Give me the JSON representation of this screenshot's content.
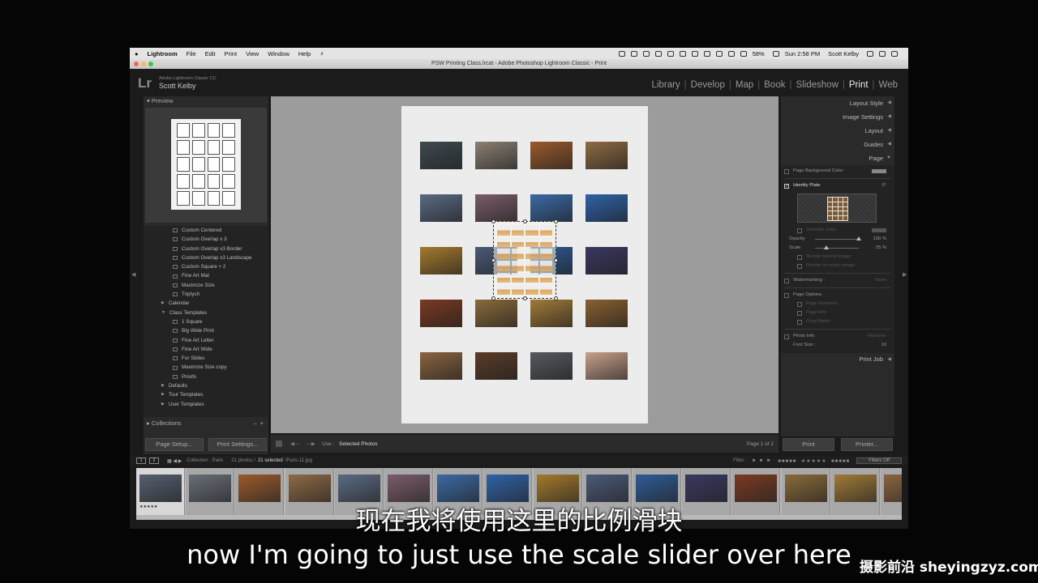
{
  "menubar": {
    "apple_icon": "apple-icon",
    "app": "Lightroom",
    "items": [
      "File",
      "Edit",
      "Print",
      "View",
      "Window",
      "Help"
    ],
    "battery": "58%",
    "clock": "Sun 2:58 PM",
    "user": "Scott Kelby"
  },
  "titlebar": {
    "title": "PSW Printing Class.lrcat - Adobe Photoshop Lightroom Classic - Print"
  },
  "identity": {
    "logo": "Lr",
    "product": "Adobe Lightroom Classic CC",
    "user": "Scott Kelby"
  },
  "modules": [
    "Library",
    "Develop",
    "Map",
    "Book",
    "Slideshow",
    "Print",
    "Web"
  ],
  "active_module": "Print",
  "left_panel": {
    "preview_header": "Preview",
    "template_rows": [
      {
        "type": "item",
        "label": "Custom Centered"
      },
      {
        "type": "item",
        "label": "Custom Overlap x 3"
      },
      {
        "type": "item",
        "label": "Custom Overlap x3 Border"
      },
      {
        "type": "item",
        "label": "Custom Overlap x3 Landscape"
      },
      {
        "type": "item",
        "label": "Custom Square + 2"
      },
      {
        "type": "item",
        "label": "Fine Art Mat"
      },
      {
        "type": "item",
        "label": "Maximize Size"
      },
      {
        "type": "item",
        "label": "Triptych"
      },
      {
        "type": "folder",
        "label": "Calendar",
        "open": false
      },
      {
        "type": "folder",
        "label": "Class Templates",
        "open": true
      },
      {
        "type": "item",
        "label": "1 Square"
      },
      {
        "type": "item",
        "label": "Big Wide Print"
      },
      {
        "type": "item",
        "label": "Fine Art Letter"
      },
      {
        "type": "item",
        "label": "Fine Art Wide"
      },
      {
        "type": "item",
        "label": "For Slides"
      },
      {
        "type": "item",
        "label": "Maximize Size copy"
      },
      {
        "type": "item",
        "label": "Proofs"
      },
      {
        "type": "folder",
        "label": "Defaults",
        "open": false
      },
      {
        "type": "folder",
        "label": "Tour Templates",
        "open": false
      },
      {
        "type": "folder",
        "label": "User Templates",
        "open": false
      }
    ],
    "collections_header": "Collections",
    "page_setup": "Page Setup...",
    "print_settings": "Print Settings..."
  },
  "toolbar": {
    "use_label": "Use :",
    "use_value": "Selected Photos",
    "page_counter": "Page 1 of 2"
  },
  "page_thumbs": [
    "#3e4a50",
    "#8a7f72",
    "#9a5a2c",
    "#8e6a44",
    "#5a6a84",
    "#7a5c6c",
    "#3b6aa4",
    "#2f63a8",
    "#a57a2c",
    "#4a5a78",
    "#2f5c96",
    "#3a3860",
    "#7a3a22",
    "#8a6a3a",
    "#a07a38",
    "#8a6030",
    "#8a6440",
    "#5a3c28",
    "#555a60",
    "#c8a08a"
  ],
  "right_panel": {
    "sections": [
      "Layout Style",
      "Image Settings",
      "Layout",
      "Guides",
      "Page"
    ],
    "page_bg": "Page Background Color",
    "identity_plate": "Identity Plate",
    "identity_angle": "0°",
    "override_color": "Override Color",
    "opacity_label": "Opacity",
    "opacity_value": "100",
    "opacity_unit": "%",
    "opacity_level": 1.0,
    "scale_label": "Scale",
    "scale_value": "25",
    "scale_unit": "%",
    "scale_level": 0.25,
    "render_behind": "Render behind image",
    "render_every": "Render on every image",
    "watermarking": "Watermarking :",
    "watermark_value": "None",
    "page_options": "Page Options",
    "page_numbers": "Page Numbers",
    "page_info": "Page Info",
    "crop_marks": "Crop Marks",
    "photo_info": "Photo Info",
    "photo_info_value": "Filename",
    "font_size_label": "Font Size :",
    "font_size_value": "10",
    "print_job": "Print Job",
    "print": "Print",
    "printer": "Printer..."
  },
  "filmstrip_bar": {
    "view1": "1",
    "view2": "2",
    "collection": "Collection : Paris",
    "count": "21 photos /",
    "selected": "21 selected",
    "file": "/Paris-11.jpg",
    "filter": "Filter :",
    "filters_off": "Filters Off"
  },
  "film_thumbs": [
    "#556070",
    "#6a7078",
    "#9a5a2c",
    "#8e6a44",
    "#5a6a84",
    "#7a5c6c",
    "#3b6aa4",
    "#2f63a8",
    "#a57a2c",
    "#4a5a78",
    "#2f5c96",
    "#3a3860",
    "#7a3a22",
    "#8a6a3a",
    "#a07a38",
    "#8a6440"
  ],
  "film_rating": "★★★★★",
  "subtitles": {
    "zh": "现在我将使用这里的比例滑块",
    "en": "now I'm going to just use the scale slider over here"
  },
  "watermark": "摄影前沿 sheyingzyz.com",
  "colors": {
    "menubar": "#e4e4e4",
    "panel": "#2a2a2a",
    "canvas": "#9c9c9c",
    "active_module": "#eeeeee"
  }
}
